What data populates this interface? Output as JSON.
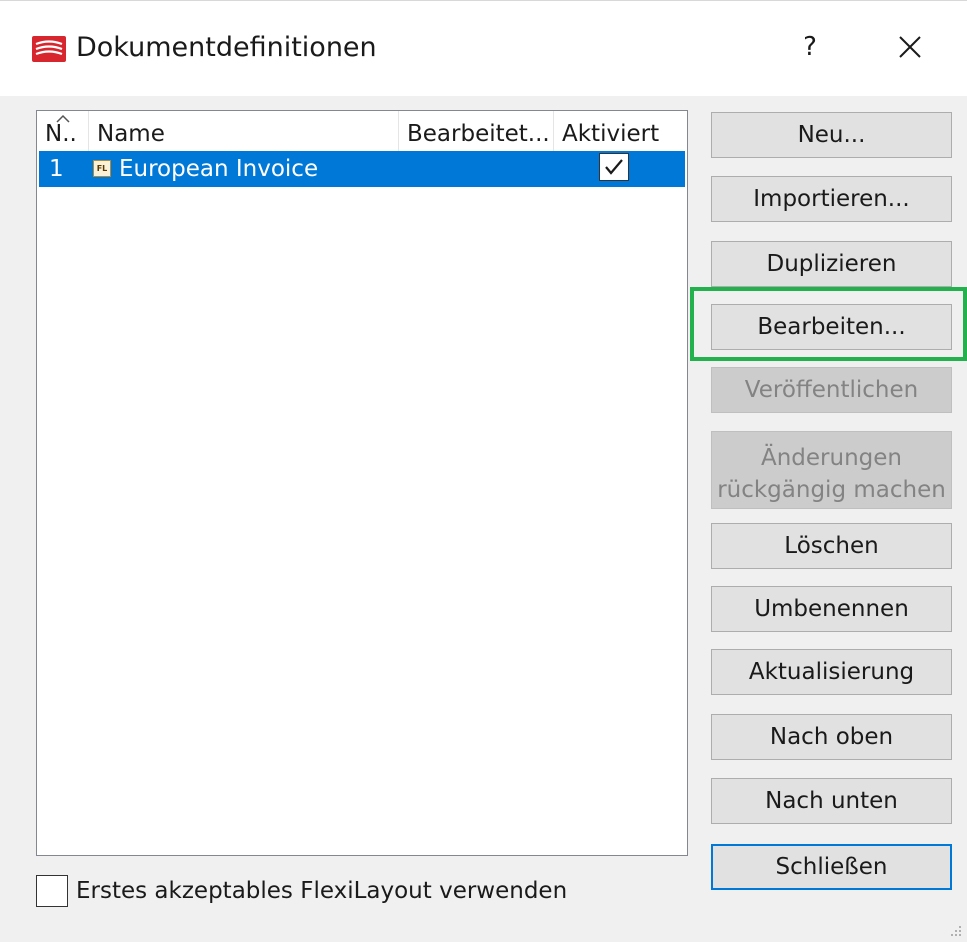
{
  "window": {
    "title": "Dokumentdefinitionen",
    "help_glyph": "?",
    "close_icon": "close-icon",
    "app_icon": "flexicapture-logo-icon"
  },
  "listview": {
    "columns": [
      "N..",
      "Name",
      "Bearbeitet...",
      "Aktiviert"
    ],
    "sort_indicator": "up-arrow-icon",
    "rows": [
      {
        "number": "1",
        "icon_text": "FL",
        "name": "European Invoice",
        "edited": "",
        "activated": true,
        "selected": true
      }
    ]
  },
  "buttons": {
    "new": "Neu...",
    "import": "Importieren...",
    "duplicate": "Duplizieren",
    "edit": "Bearbeiten...",
    "publish": "Veröffentlichen",
    "undo_line1": "Änderungen",
    "undo_line2": "rückgängig machen",
    "delete": "Löschen",
    "rename": "Umbenennen",
    "update": "Aktualisierung",
    "move_up": "Nach oben",
    "move_down": "Nach unten",
    "close": "Schließen"
  },
  "options": {
    "first_flexilayout_label": "Erstes akzeptables FlexiLayout verwenden",
    "first_flexilayout_checked": false
  },
  "colors": {
    "selection": "#0078d7",
    "highlight_frame": "#22b14c",
    "logo_red": "#d7262e"
  }
}
